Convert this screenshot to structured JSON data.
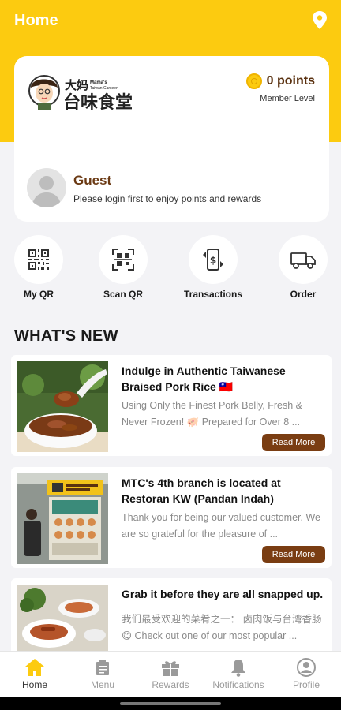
{
  "header": {
    "title": "Home",
    "location_icon": "location-pin-icon"
  },
  "colors": {
    "accent": "#fccb10",
    "brand_brown": "#7a3d12",
    "background": "#f3f3f6"
  },
  "profile_card": {
    "logo_text_cn": "大妈台味食堂",
    "logo_text_en": "Mama's Taiwan Canteen",
    "points": "0 points",
    "member_level": "Member Level",
    "name": "Guest",
    "message": "Please login first to enjoy points and rewards"
  },
  "quick_actions": [
    {
      "label": "My QR",
      "icon": "qr-code-icon"
    },
    {
      "label": "Scan QR",
      "icon": "scan-qr-icon"
    },
    {
      "label": "Transactions",
      "icon": "transactions-icon"
    },
    {
      "label": "Order",
      "icon": "delivery-truck-icon"
    }
  ],
  "whats_new": {
    "title": "WHAT'S NEW",
    "items": [
      {
        "title": "Indulge in Authentic Taiwanese Braised Pork Rice 🇹🇼",
        "desc": "Using Only the Finest Pork Belly, Fresh & Never Frozen! 🐖 Prepared for Over 8 ...",
        "button": "Read More"
      },
      {
        "title": "MTC's 4th branch is located at Restoran KW (Pandan Indah)",
        "desc": "Thank you for being our valued customer. We are so grateful for the pleasure of ...",
        "button": "Read More"
      },
      {
        "title": "Grab it before they are all snapped up.",
        "desc": "我们最受欢迎的菜肴之一： 卤肉饭与台湾香肠😋 Check out one of our most popular ..."
      }
    ]
  },
  "bottom_nav": [
    {
      "label": "Home",
      "icon": "home-icon",
      "active": true
    },
    {
      "label": "Menu",
      "icon": "menu-icon"
    },
    {
      "label": "Rewards",
      "icon": "gift-icon"
    },
    {
      "label": "Notifications",
      "icon": "bell-icon"
    },
    {
      "label": "Profile",
      "icon": "profile-icon"
    }
  ]
}
